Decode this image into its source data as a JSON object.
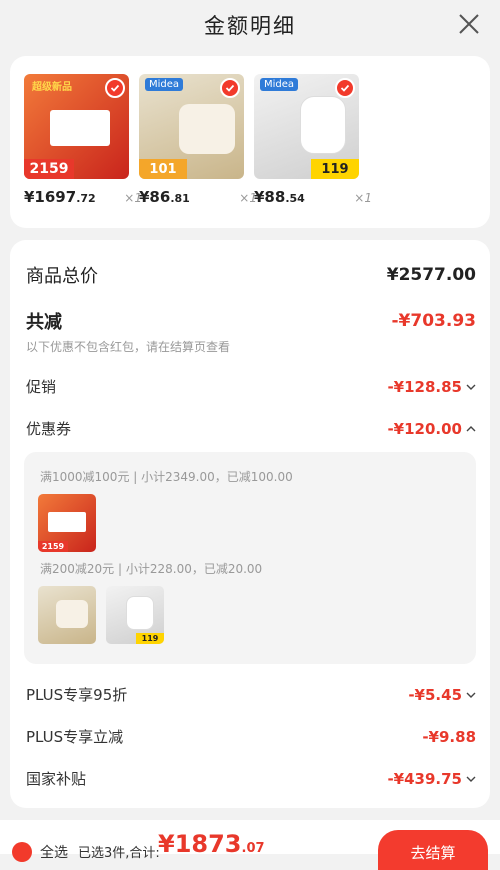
{
  "header": {
    "title": "金额明细"
  },
  "products": [
    {
      "price_int": "¥1697",
      "price_dec": ".72",
      "qty": "×1",
      "badge": "超级新品",
      "tag": "2159",
      "color": "#e85a2a"
    },
    {
      "price_int": "¥86",
      "price_dec": ".81",
      "qty": "×1",
      "badge": "Midea",
      "tag": "101",
      "color": "#d9c9a8"
    },
    {
      "price_int": "¥88",
      "price_dec": ".54",
      "qty": "×1",
      "badge": "Midea",
      "tag": "119",
      "color": "#d8d8d8"
    }
  ],
  "summary": {
    "total_label": "商品总价",
    "total_value": "¥2577.00",
    "discount_label": "共减",
    "discount_value": "-¥703.93",
    "discount_note": "以下优惠不包含红包，请在结算页查看",
    "promo_label": "促销",
    "promo_value": "-¥128.85",
    "coupon_label": "优惠券",
    "coupon_value": "-¥120.00",
    "coupon_group1": "满1000减100元 | 小计2349.00，已减100.00",
    "coupon_group2": "满200减20元 | 小计228.00，已减20.00",
    "plus95_label": "PLUS专享95折",
    "plus95_value": "-¥5.45",
    "plusdirect_label": "PLUS专享立减",
    "plusdirect_value": "-¥9.88",
    "subsidy_label": "国家补贴",
    "subsidy_value": "-¥439.75"
  },
  "bottom": {
    "select_all": "全选",
    "selected_text": "已选3件,合计:",
    "total_int": "¥1873",
    "total_dec": ".07",
    "checkout": "去结算"
  },
  "colors": {
    "accent": "#e8382b",
    "accent_bg": "#f23a2b"
  },
  "icons": {
    "close": "close-icon",
    "check": "check-icon",
    "chevron_down": "chevron-down-icon",
    "chevron_up": "chevron-up-icon"
  }
}
